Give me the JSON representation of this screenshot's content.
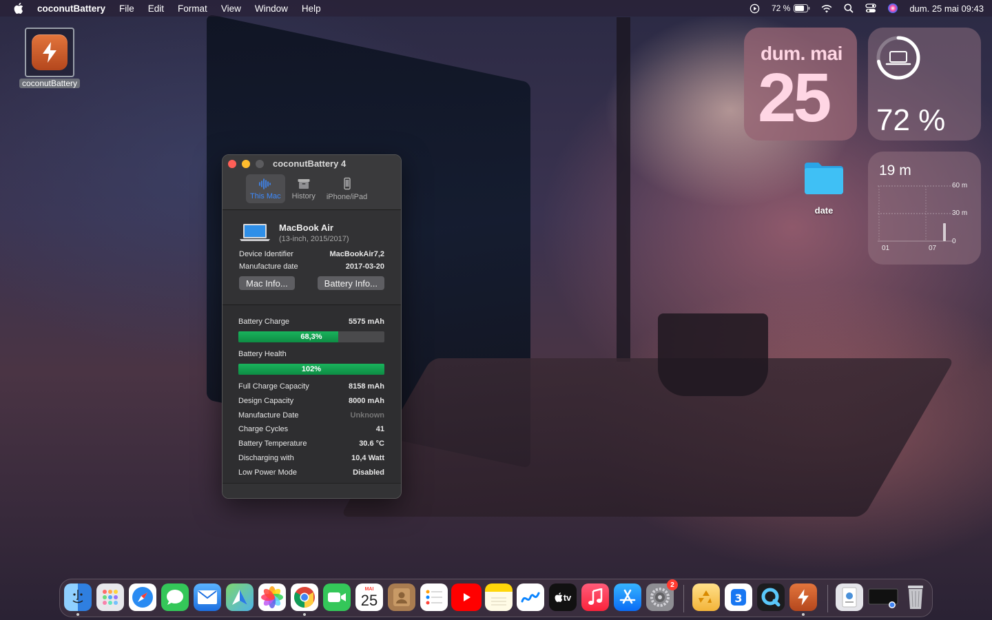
{
  "menubar": {
    "app_name": "coconutBattery",
    "menus": [
      "File",
      "Edit",
      "Format",
      "View",
      "Window",
      "Help"
    ],
    "battery_percent": "72 %",
    "datetime": "dum. 25 mai  09:43"
  },
  "desktop": {
    "app_icon_label": "coconutBattery",
    "folder_label": "date"
  },
  "widgets": {
    "calendar": {
      "day": "dum. mai",
      "date": "25"
    },
    "battery": {
      "percent_text": "72 %",
      "level": 0.72
    },
    "screen_time": {
      "title": "19 m",
      "y_ticks": [
        "60 m",
        "30 m",
        "0"
      ],
      "x_ticks": [
        "01",
        "07"
      ]
    }
  },
  "window": {
    "title": "coconutBattery 4",
    "tabs": [
      {
        "label": "This Mac",
        "active": true
      },
      {
        "label": "History",
        "active": false
      },
      {
        "label": "iPhone/iPad",
        "active": false
      }
    ],
    "device": {
      "name": "MacBook Air",
      "model": "(13-inch, 2015/2017)",
      "identifier_label": "Device Identifier",
      "identifier": "MacBookAir7,2",
      "manufacture_label": "Manufacture date",
      "manufacture": "2017-03-20",
      "mac_info_button": "Mac Info...",
      "battery_info_button": "Battery Info..."
    },
    "battery": {
      "charge_label": "Battery Charge",
      "charge_value": "5575 mAh",
      "charge_bar_text": "68,3%",
      "charge_fraction": 0.683,
      "health_label": "Battery Health",
      "health_bar_text": "102%",
      "health_fraction": 1.0,
      "rows": [
        {
          "label": "Full Charge Capacity",
          "value": "8158 mAh"
        },
        {
          "label": "Design Capacity",
          "value": "8000 mAh"
        },
        {
          "label": "Manufacture Date",
          "value": "Unknown",
          "muted": true
        },
        {
          "label": "Charge Cycles",
          "value": "41"
        },
        {
          "label": "Battery Temperature",
          "value": "30.6 °C"
        },
        {
          "label": "Discharging with",
          "value": "10,4 Watt"
        },
        {
          "label": "Low Power Mode",
          "value": "Disabled"
        }
      ]
    }
  },
  "dock": {
    "calendar_month": "MAI",
    "calendar_day": "25",
    "settings_badge": "2",
    "tv_label": "tv"
  }
}
